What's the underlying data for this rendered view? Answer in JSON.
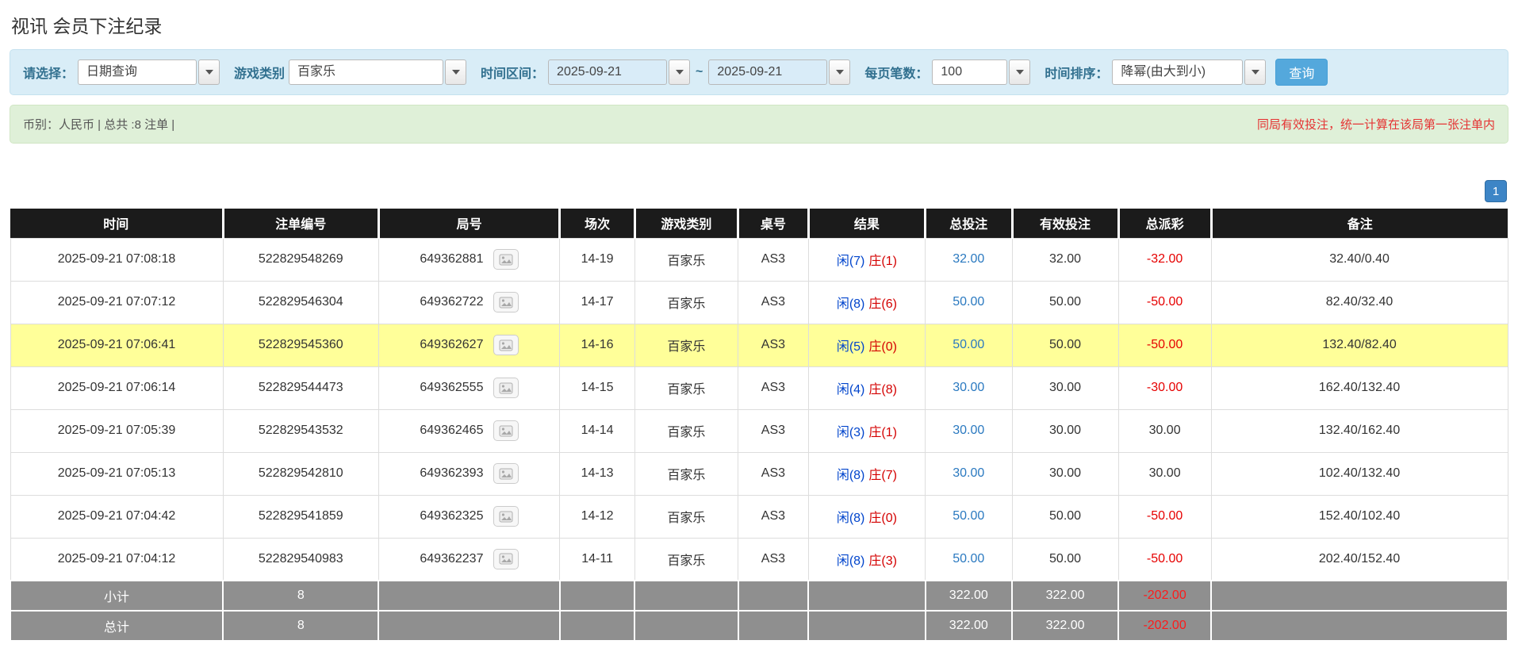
{
  "page": {
    "title": "视讯 会员下注纪录"
  },
  "filters": {
    "date_type_label": "请选择：",
    "date_type_value": "日期查询",
    "game_type_label": "游戏类别",
    "game_type_value": "百家乐",
    "time_range_label": "时间区间：",
    "date_from": "2025-09-21",
    "range_separator": "~",
    "date_to": "2025-09-21",
    "page_size_label": "每页笔数：",
    "page_size_value": "100",
    "sort_label": "时间排序：",
    "sort_value": "降幂(由大到小)",
    "search_button_label": "查询"
  },
  "summary": {
    "left_text": "币别：人民币 | 总共 :8 注单 |",
    "right_notice": "同局有效投注，统一计算在该局第一张注单内"
  },
  "pagination": {
    "current_page": "1"
  },
  "colors": {
    "accent_blue": "#54a8dc",
    "link_blue": "#2a79c0",
    "player_blue": "#0044cc",
    "banker_red": "#d40000",
    "negative_red": "#e60000",
    "highlight_yellow": "#ffff99"
  },
  "table": {
    "headers": [
      "时间",
      "注单编号",
      "局号",
      "场次",
      "游戏类别",
      "桌号",
      "结果",
      "总投注",
      "有效投注",
      "总派彩",
      "备注"
    ],
    "rows": [
      {
        "time": "2025-09-21 07:08:18",
        "bet_id": "522829548269",
        "round_no": "649362881",
        "session": "14-19",
        "game": "百家乐",
        "table_no": "AS3",
        "result_player": "闲(7)",
        "result_banker": "庄(1)",
        "total_bet": "32.00",
        "valid_bet": "32.00",
        "payout": "-32.00",
        "note": "32.40/0.40",
        "highlighted": false
      },
      {
        "time": "2025-09-21 07:07:12",
        "bet_id": "522829546304",
        "round_no": "649362722",
        "session": "14-17",
        "game": "百家乐",
        "table_no": "AS3",
        "result_player": "闲(8)",
        "result_banker": "庄(6)",
        "total_bet": "50.00",
        "valid_bet": "50.00",
        "payout": "-50.00",
        "note": "82.40/32.40",
        "highlighted": false
      },
      {
        "time": "2025-09-21 07:06:41",
        "bet_id": "522829545360",
        "round_no": "649362627",
        "session": "14-16",
        "game": "百家乐",
        "table_no": "AS3",
        "result_player": "闲(5)",
        "result_banker": "庄(0)",
        "total_bet": "50.00",
        "valid_bet": "50.00",
        "payout": "-50.00",
        "note": "132.40/82.40",
        "highlighted": true
      },
      {
        "time": "2025-09-21 07:06:14",
        "bet_id": "522829544473",
        "round_no": "649362555",
        "session": "14-15",
        "game": "百家乐",
        "table_no": "AS3",
        "result_player": "闲(4)",
        "result_banker": "庄(8)",
        "total_bet": "30.00",
        "valid_bet": "30.00",
        "payout": "-30.00",
        "note": "162.40/132.40",
        "highlighted": false
      },
      {
        "time": "2025-09-21 07:05:39",
        "bet_id": "522829543532",
        "round_no": "649362465",
        "session": "14-14",
        "game": "百家乐",
        "table_no": "AS3",
        "result_player": "闲(3)",
        "result_banker": "庄(1)",
        "total_bet": "30.00",
        "valid_bet": "30.00",
        "payout": "30.00",
        "note": "132.40/162.40",
        "highlighted": false
      },
      {
        "time": "2025-09-21 07:05:13",
        "bet_id": "522829542810",
        "round_no": "649362393",
        "session": "14-13",
        "game": "百家乐",
        "table_no": "AS3",
        "result_player": "闲(8)",
        "result_banker": "庄(7)",
        "total_bet": "30.00",
        "valid_bet": "30.00",
        "payout": "30.00",
        "note": "102.40/132.40",
        "highlighted": false
      },
      {
        "time": "2025-09-21 07:04:42",
        "bet_id": "522829541859",
        "round_no": "649362325",
        "session": "14-12",
        "game": "百家乐",
        "table_no": "AS3",
        "result_player": "闲(8)",
        "result_banker": "庄(0)",
        "total_bet": "50.00",
        "valid_bet": "50.00",
        "payout": "-50.00",
        "note": "152.40/102.40",
        "highlighted": false
      },
      {
        "time": "2025-09-21 07:04:12",
        "bet_id": "522829540983",
        "round_no": "649362237",
        "session": "14-11",
        "game": "百家乐",
        "table_no": "AS3",
        "result_player": "闲(8)",
        "result_banker": "庄(3)",
        "total_bet": "50.00",
        "valid_bet": "50.00",
        "payout": "-50.00",
        "note": "202.40/152.40",
        "highlighted": false
      }
    ],
    "subtotal": {
      "label": "小计",
      "count": "8",
      "total_bet": "322.00",
      "valid_bet": "322.00",
      "payout": "-202.00"
    },
    "total": {
      "label": "总计",
      "count": "8",
      "total_bet": "322.00",
      "valid_bet": "322.00",
      "payout": "-202.00"
    }
  }
}
